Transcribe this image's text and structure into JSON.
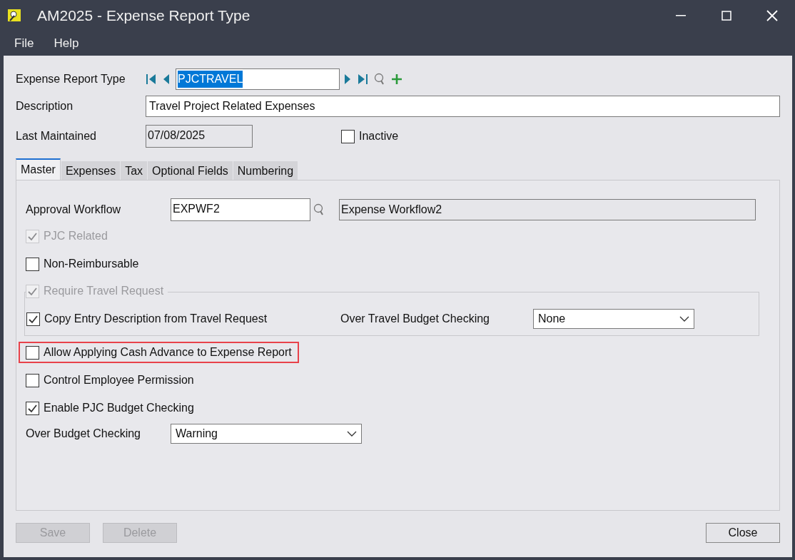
{
  "window": {
    "title": "AM2025 - Expense Report Type"
  },
  "menu": [
    "File",
    "Help"
  ],
  "header": {
    "type_label": "Expense Report Type",
    "type_value": "PJCTRAVEL",
    "type_value_selected": true,
    "description_label": "Description",
    "description_value": "Travel Project Related Expenses",
    "last_maintained_label": "Last Maintained",
    "last_maintained_value": "07/08/2025",
    "inactive": {
      "label": "Inactive",
      "checked": false,
      "disabled": false
    }
  },
  "tabs": [
    {
      "label": "Master",
      "selected": true
    },
    {
      "label": "Expenses",
      "selected": false
    },
    {
      "label": "Tax",
      "selected": false
    },
    {
      "label": "Optional Fields",
      "selected": false
    },
    {
      "label": "Numbering",
      "selected": false
    }
  ],
  "master": {
    "approval_workflow": {
      "label": "Approval Workflow",
      "value": "EXPWF2",
      "description": "Expense Workflow2"
    },
    "options": [
      {
        "label": "PJC Related",
        "checked": true,
        "disabled": true
      },
      {
        "label": "Non-Reimbursable",
        "checked": false,
        "disabled": false
      }
    ],
    "travel_group": {
      "require": {
        "label": "Require Travel Request",
        "checked": true,
        "disabled": true
      },
      "copy": {
        "label": "Copy Entry Description from Travel Request",
        "checked": true,
        "disabled": false
      },
      "budget": {
        "label": "Over Travel Budget Checking",
        "value": "None"
      }
    },
    "options2": [
      {
        "label": "Allow Applying Cash Advance to Expense Report",
        "checked": false,
        "disabled": false,
        "highlighted": true
      },
      {
        "label": "Control Employee Permission",
        "checked": false,
        "disabled": false,
        "highlighted": false
      },
      {
        "label": "Enable PJC Budget Checking",
        "checked": true,
        "disabled": false,
        "highlighted": false
      }
    ],
    "over_budget": {
      "label": "Over Budget Checking",
      "value": "Warning"
    }
  },
  "buttons": [
    {
      "label": "Save",
      "disabled": true
    },
    {
      "label": "Delete",
      "disabled": true
    },
    {
      "label": "Close",
      "disabled": false
    }
  ]
}
